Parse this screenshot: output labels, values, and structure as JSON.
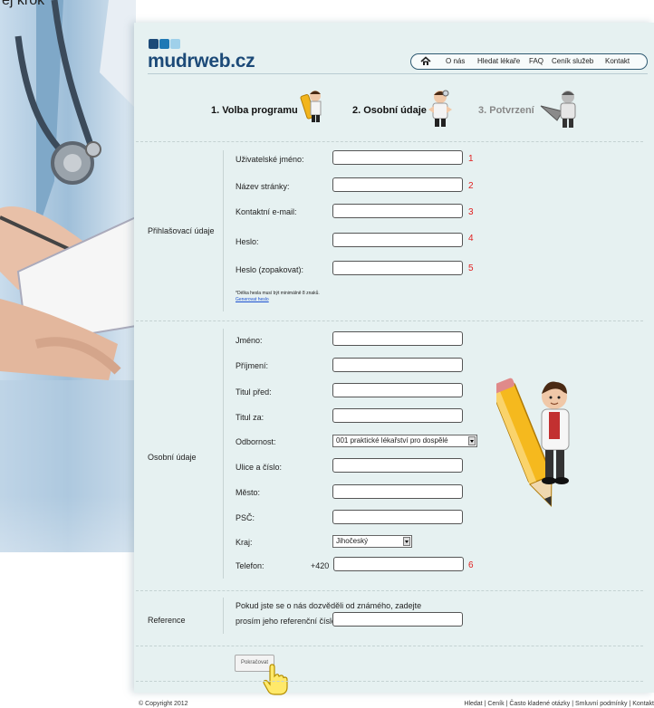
{
  "corner_text": "ej krok",
  "logo": {
    "text": "mudrweb.cz",
    "colors": [
      "#1c4a78",
      "#1f79b5",
      "#9fd0ea"
    ]
  },
  "nav": {
    "items": [
      "O nás",
      "Hledat lékaře",
      "FAQ",
      "Ceník služeb",
      "Kontakt"
    ],
    "home_icon": "home-icon"
  },
  "steps": [
    {
      "label": "1. Volba programu",
      "state": "active"
    },
    {
      "label": "2. Osobní údaje",
      "state": "active"
    },
    {
      "label": "3. Potvrzení",
      "state": "inactive"
    }
  ],
  "login": {
    "section_label": "Přihlašovací údaje",
    "fields": [
      {
        "label": "Uživatelské jméno:",
        "value": "",
        "num": "1"
      },
      {
        "label": "Název stránky:",
        "value": "",
        "num": "2"
      },
      {
        "label": "Kontaktní e-mail:",
        "value": "",
        "num": "3"
      },
      {
        "label": "Heslo:",
        "value": "",
        "num": "4"
      },
      {
        "label": "Heslo (zopakovat):",
        "value": "",
        "num": "5"
      }
    ],
    "note": "*Délka hesla musí být minimálně 8 znaků.",
    "generate_link": "Generovat heslo"
  },
  "personal": {
    "section_label": "Osobní údaje",
    "fields": [
      {
        "label": "Jméno:",
        "value": ""
      },
      {
        "label": "Příjmení:",
        "value": ""
      },
      {
        "label": "Titul před:",
        "value": ""
      },
      {
        "label": "Titul za:",
        "value": ""
      },
      {
        "label": "Odbornost:",
        "value": "001 praktické lékařství pro dospělé"
      },
      {
        "label": "Ulice a číslo:",
        "value": ""
      },
      {
        "label": "Město:",
        "value": ""
      },
      {
        "label": "PSČ:",
        "value": ""
      },
      {
        "label": "Kraj:",
        "value": "Jihočeský"
      },
      {
        "label": "Telefon:",
        "value": ""
      }
    ],
    "phone_prefix": "+420",
    "phone_num": "6"
  },
  "reference": {
    "section_label": "Reference",
    "text_line1": "Pokud jste se o nás dozvěděli od známého, zadejte",
    "text_line2": "prosím jeho referenční číslo:",
    "value": ""
  },
  "submit_label": "Pokračovat",
  "footer": {
    "copyright": "© Copyright 2012",
    "links": "Hledat | Ceník | Často kladené otázky | Smluvní podmínky | Kontakt"
  }
}
